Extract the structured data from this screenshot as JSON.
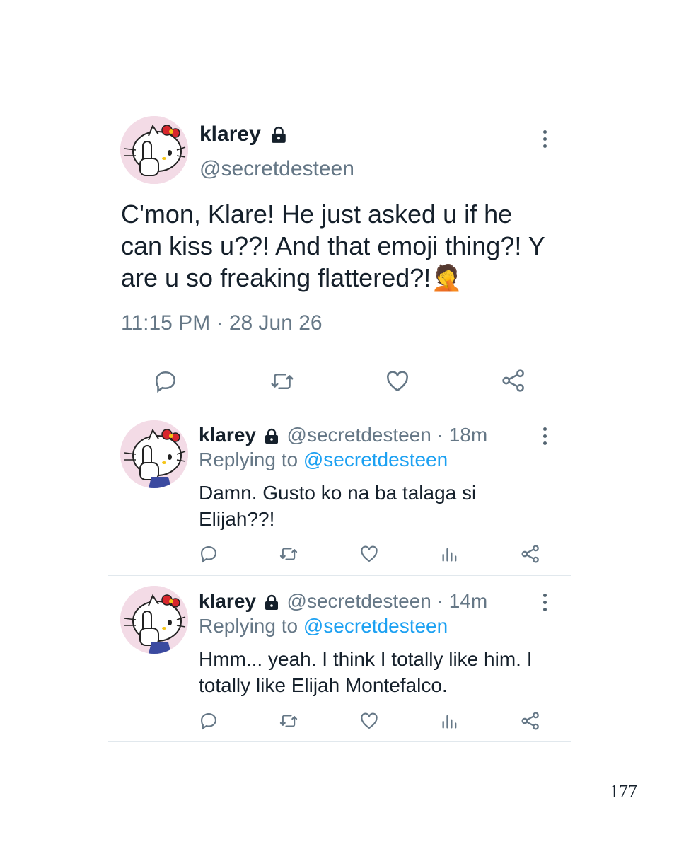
{
  "main_tweet": {
    "display_name": "klarey",
    "handle": "@secretdesteen",
    "text_line1": "C'mon, Klare! He just asked u if he",
    "text_line2": "can kiss u??! And that emoji thing?! Y",
    "text_line3": "are u so freaking flattered?!",
    "emoji": "🤦",
    "timestamp": "11:15 PM · 28 Jun 26"
  },
  "replies": [
    {
      "display_name": "klarey",
      "handle_time": "@secretdesteen · 18m",
      "replying_prefix": "Replying to",
      "replying_handle": "@secretdesteen",
      "text_line1": "Damn. Gusto ko na ba talaga si",
      "text_line2": "Elijah??!"
    },
    {
      "display_name": "klarey",
      "handle_time": "@secretdesteen · 14m",
      "replying_prefix": "Replying to",
      "replying_handle": "@secretdesteen",
      "text_line1": "Hmm... yeah. I think I totally like him. I",
      "text_line2": "totally like Elijah Montefalco."
    }
  ],
  "page_number": "177",
  "icons": {
    "reply": "reply-icon",
    "retweet": "retweet-icon",
    "like": "heart-icon",
    "analytics": "analytics-icon",
    "share": "share-icon",
    "lock": "lock-icon",
    "more": "more-options-icon"
  },
  "colors": {
    "text": "#15202b",
    "muted": "#657786",
    "link": "#1da1f2",
    "divider": "#e1e8ed"
  }
}
